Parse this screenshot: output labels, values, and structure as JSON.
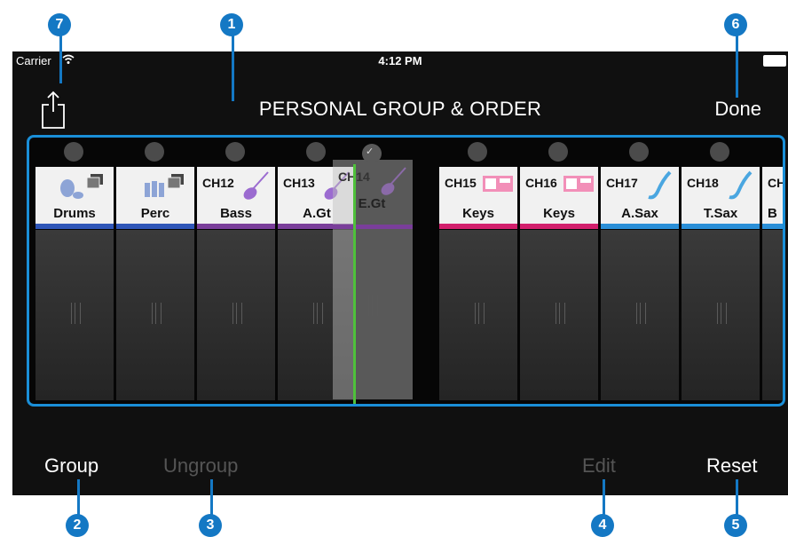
{
  "status": {
    "carrier": "Carrier",
    "time": "4:12 PM"
  },
  "header": {
    "title": "PERSONAL GROUP & ORDER",
    "done": "Done"
  },
  "channels": [
    {
      "num": "",
      "name": "Drums",
      "color": "#2f56b8",
      "icon": "drums-icon"
    },
    {
      "num": "",
      "name": "Perc",
      "color": "#2f56b8",
      "icon": "percussion-icon"
    },
    {
      "num": "CH12",
      "name": "Bass",
      "color": "#7a3e9a",
      "icon": "bass-guitar-icon"
    },
    {
      "num": "CH13",
      "name": "A.Gt",
      "color": "#7a3e9a",
      "icon": "acoustic-guitar-icon"
    },
    {
      "num": "CH15",
      "name": "Keys",
      "color": "#d21f6c",
      "icon": "keyboard-icon"
    },
    {
      "num": "CH16",
      "name": "Keys",
      "color": "#d21f6c",
      "icon": "keyboard-icon"
    },
    {
      "num": "CH17",
      "name": "A.Sax",
      "color": "#2a8fd8",
      "icon": "saxophone-icon"
    },
    {
      "num": "CH18",
      "name": "T.Sax",
      "color": "#2a8fd8",
      "icon": "saxophone-icon"
    },
    {
      "num": "CH",
      "name": "B",
      "color": "#2a8fd8",
      "icon": ""
    }
  ],
  "dragged": {
    "num": "CH14",
    "name": "E.Gt",
    "color": "#7a3e9a",
    "icon": "electric-guitar-icon"
  },
  "bottom": {
    "group": "Group",
    "ungroup": "Ungroup",
    "edit": "Edit",
    "reset": "Reset"
  },
  "callouts": [
    "1",
    "2",
    "3",
    "4",
    "5",
    "6",
    "7"
  ]
}
